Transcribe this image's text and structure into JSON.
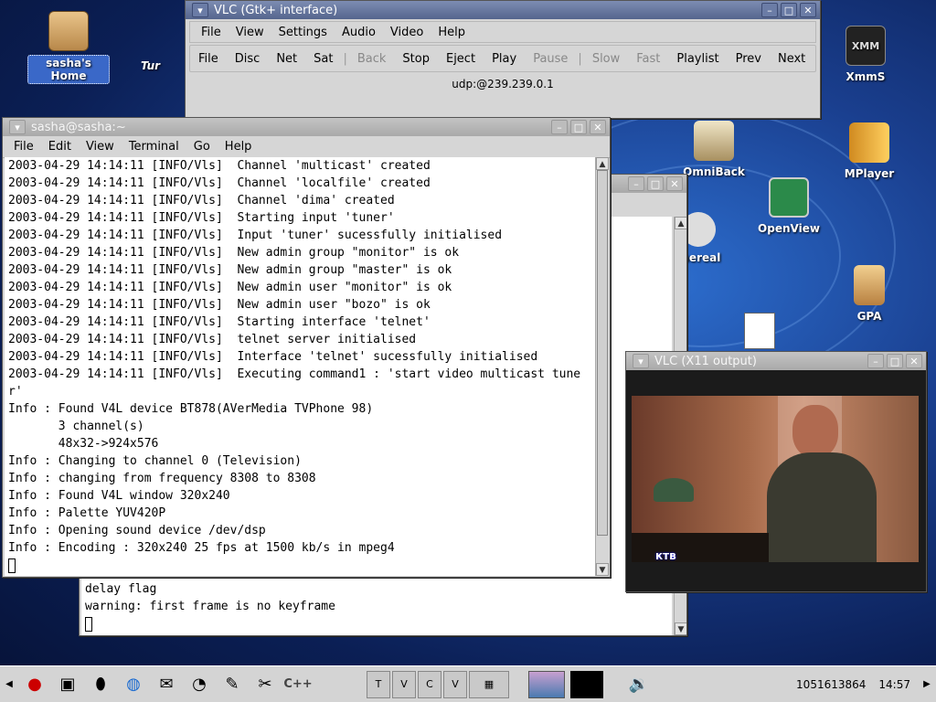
{
  "desktop": {
    "icons": [
      {
        "label": "sasha's Home"
      },
      {
        "label": "Tur"
      },
      {
        "label": "XmmS"
      },
      {
        "label": "OmniBack"
      },
      {
        "label": "MPlayer"
      },
      {
        "label": "OpenView"
      },
      {
        "label": "thereal"
      },
      {
        "label": "GPA"
      }
    ]
  },
  "vlc_main": {
    "title": "VLC (Gtk+ interface)",
    "menu": [
      "File",
      "View",
      "Settings",
      "Audio",
      "Video",
      "Help"
    ],
    "toolbar": [
      "File",
      "Disc",
      "Net",
      "Sat",
      "Back",
      "Stop",
      "Eject",
      "Play",
      "Pause",
      "Slow",
      "Fast",
      "Playlist",
      "Prev",
      "Next"
    ],
    "stream": "udp:@239.239.0.1"
  },
  "terminal": {
    "title": "sasha@sasha:~",
    "menu": [
      "File",
      "Edit",
      "View",
      "Terminal",
      "Go",
      "Help"
    ],
    "lines": [
      "2003-04-29 14:14:11 [INFO/Vls]  Channel 'multicast' created",
      "2003-04-29 14:14:11 [INFO/Vls]  Channel 'localfile' created",
      "2003-04-29 14:14:11 [INFO/Vls]  Channel 'dima' created",
      "2003-04-29 14:14:11 [INFO/Vls]  Starting input 'tuner'",
      "2003-04-29 14:14:11 [INFO/Vls]  Input 'tuner' sucessfully initialised",
      "2003-04-29 14:14:11 [INFO/Vls]  New admin group \"monitor\" is ok",
      "2003-04-29 14:14:11 [INFO/Vls]  New admin group \"master\" is ok",
      "2003-04-29 14:14:11 [INFO/Vls]  New admin user \"monitor\" is ok",
      "2003-04-29 14:14:11 [INFO/Vls]  New admin user \"bozo\" is ok",
      "2003-04-29 14:14:11 [INFO/Vls]  Starting interface 'telnet'",
      "2003-04-29 14:14:11 [INFO/Vls]  telnet server initialised",
      "2003-04-29 14:14:11 [INFO/Vls]  Interface 'telnet' sucessfully initialised",
      "2003-04-29 14:14:11 [INFO/Vls]  Executing command1 : 'start video multicast tune",
      "r'",
      "Info : Found V4L device BT878(AVerMedia TVPhone 98)",
      "       3 channel(s)",
      "       48x32->924x576",
      "Info : Changing to channel 0 (Television)",
      "Info : changing from frequency 8308 to 8308",
      "Info : Found V4L window 320x240",
      "Info : Palette YUV420P",
      "Info : Opening sound device /dev/dsp",
      "Info : Encoding : 320x240 25 fps at 1500 kb/s in mpeg4"
    ]
  },
  "back_terminal": {
    "lines": [
      "delay flag",
      "warning: first frame is no keyframe"
    ]
  },
  "vlc_output": {
    "title": "VLC (X11 output)",
    "channel_logo": "ктв"
  },
  "panel": {
    "counter": "1051613864",
    "clock": "14:57"
  },
  "colors": {
    "titlebar_active": "#6b7ca6",
    "desktop": "#1a3f8f"
  }
}
